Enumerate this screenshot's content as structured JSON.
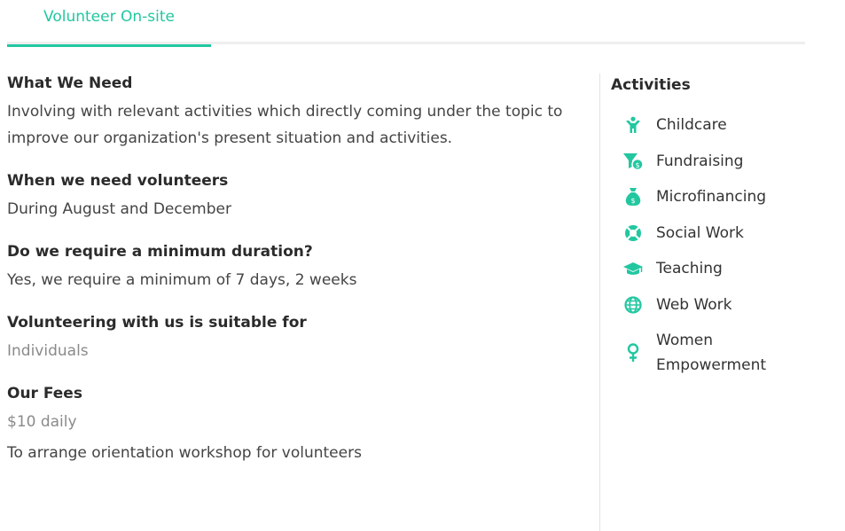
{
  "tabs": [
    {
      "label": "Volunteer On-site",
      "active": true
    }
  ],
  "accent_color": "#22c7a0",
  "main": {
    "sections": [
      {
        "heading": "What We Need",
        "lines": [
          "Involving with relevant activities which directly coming under the topic to improve our organization's present situation and activities."
        ]
      },
      {
        "heading": "When we need volunteers",
        "lines": [
          "During August and December"
        ]
      },
      {
        "heading": "Do we require a minimum duration?",
        "lines": [
          "Yes, we require a minimum of 7 days, 2 weeks"
        ]
      },
      {
        "heading": "Volunteering with us is suitable for",
        "lines": [
          "Individuals"
        ]
      },
      {
        "heading": "Our Fees",
        "lines": [
          "$10 daily",
          "To arrange orientation workshop for volunteers"
        ]
      }
    ]
  },
  "sidebar": {
    "title": "Activities",
    "items": [
      {
        "label": "Childcare",
        "icon": "child-icon"
      },
      {
        "label": "Fundraising",
        "icon": "fundraising-icon"
      },
      {
        "label": "Microfinancing",
        "icon": "money-bag-icon"
      },
      {
        "label": "Social Work",
        "icon": "lifebuoy-icon"
      },
      {
        "label": "Teaching",
        "icon": "graduation-cap-icon"
      },
      {
        "label": "Web Work",
        "icon": "globe-icon"
      },
      {
        "label": "Women Empowerment",
        "icon": "female-icon"
      }
    ]
  }
}
